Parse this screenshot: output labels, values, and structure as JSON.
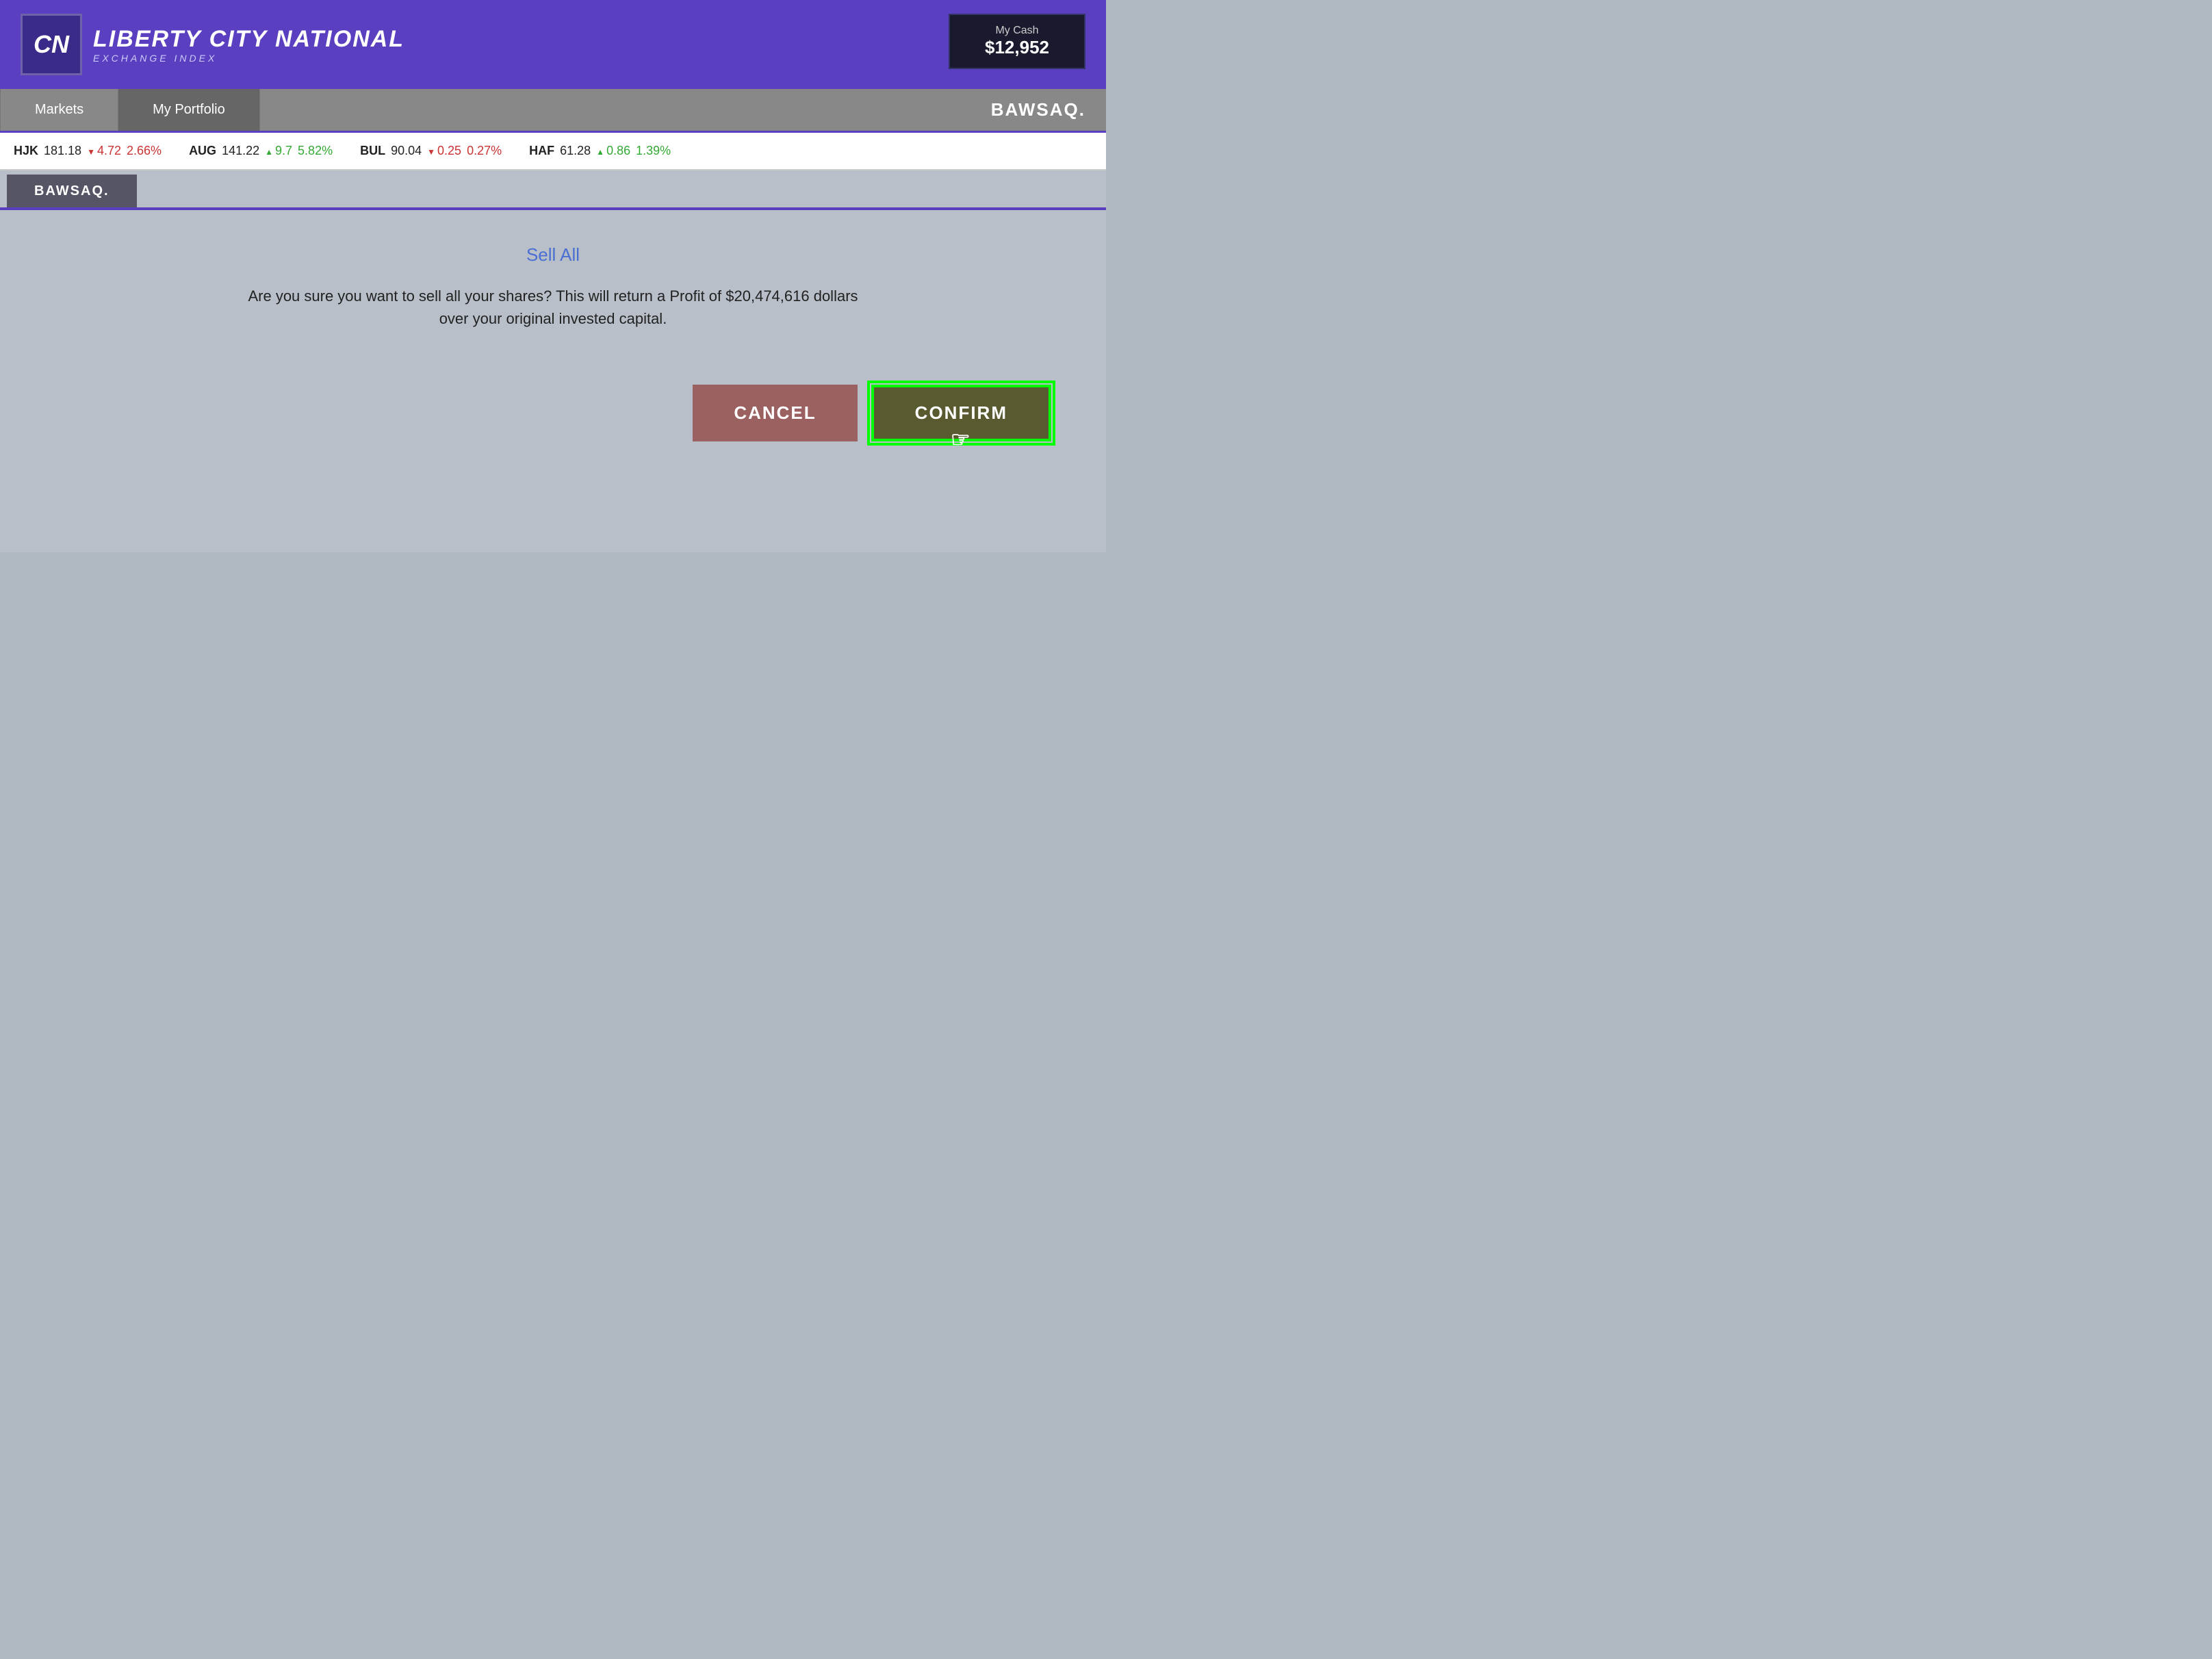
{
  "header": {
    "logo_letters": "CN",
    "brand_name": "LIBERTY CITY NATIONAL",
    "brand_sub": "EXCHANGE INDEX",
    "cash_label": "My Cash",
    "cash_amount": "$12,952"
  },
  "nav": {
    "tabs": [
      {
        "label": "Markets",
        "active": false
      },
      {
        "label": "My Portfolio",
        "active": true
      }
    ],
    "bawsaq_label": "BAWSAQ."
  },
  "ticker": {
    "items": [
      {
        "symbol": "HJK",
        "price": "181.18",
        "change": "4.72",
        "direction": "down",
        "pct": "2.66%"
      },
      {
        "symbol": "AUG",
        "price": "141.22",
        "change": "9.7",
        "direction": "up",
        "pct": "5.82%"
      },
      {
        "symbol": "BUL",
        "price": "90.04",
        "change": "0.25",
        "direction": "down",
        "pct": "0.27%"
      },
      {
        "symbol": "HAF",
        "price": "61.28",
        "change": "0.86",
        "direction": "up",
        "pct": "1.39%"
      }
    ]
  },
  "sub_tab": {
    "label": "BAWSAQ."
  },
  "dialog": {
    "title": "Sell All",
    "message": "Are you sure you want to sell all your shares? This will return a Profit of $20,474,616 dollars over your original invested capital.",
    "cancel_label": "CANCEL",
    "confirm_label": "CONFIRM"
  }
}
